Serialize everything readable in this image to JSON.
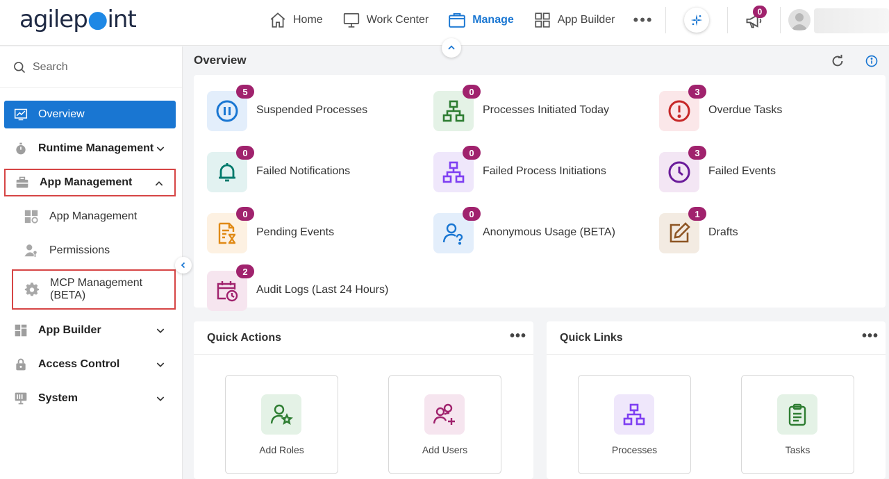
{
  "header": {
    "logo_text": "agilepoint",
    "nav": [
      {
        "label": "Home",
        "icon": "home-icon"
      },
      {
        "label": "Work Center",
        "icon": "monitor-icon"
      },
      {
        "label": "Manage",
        "icon": "briefcase-icon",
        "active": true
      },
      {
        "label": "App Builder",
        "icon": "grid-icon"
      }
    ],
    "more_label": "•••",
    "notification_count": "0",
    "accent_color": "#1976d2",
    "badge_color": "#a0226d"
  },
  "sidebar": {
    "search_placeholder": "Search",
    "items": [
      {
        "label": "Overview",
        "icon": "chart-icon",
        "active": true
      },
      {
        "label": "Runtime Management",
        "icon": "stopwatch-icon"
      },
      {
        "label": "App Management",
        "icon": "toolbox-icon",
        "expanded": true
      },
      {
        "label": "App Builder",
        "icon": "blocks-icon"
      },
      {
        "label": "Access Control",
        "icon": "lock-icon"
      },
      {
        "label": "System",
        "icon": "server-icon"
      }
    ],
    "sub_items": [
      {
        "label": "App Management",
        "icon": "app-settings-icon"
      },
      {
        "label": "Permissions",
        "icon": "user-key-icon"
      },
      {
        "label": "MCP Management (BETA)",
        "icon": "gear-icon"
      }
    ]
  },
  "overview": {
    "title": "Overview",
    "tiles": [
      {
        "label": "Suspended Processes",
        "count": "5",
        "icon": "pause-icon"
      },
      {
        "label": "Processes Initiated Today",
        "count": "0",
        "icon": "hierarchy-icon"
      },
      {
        "label": "Overdue Tasks",
        "count": "3",
        "icon": "alert-icon"
      },
      {
        "label": "Failed Notifications",
        "count": "0",
        "icon": "bell-icon"
      },
      {
        "label": "Failed Process Initiations",
        "count": "0",
        "icon": "hierarchy-icon"
      },
      {
        "label": "Failed Events",
        "count": "3",
        "icon": "clock-icon"
      },
      {
        "label": "Pending Events",
        "count": "0",
        "icon": "document-hourglass-icon"
      },
      {
        "label": "Anonymous Usage (BETA)",
        "count": "0",
        "icon": "user-question-icon"
      },
      {
        "label": "Drafts",
        "count": "1",
        "icon": "edit-icon"
      },
      {
        "label": "Audit Logs (Last 24 Hours)",
        "count": "2",
        "icon": "calendar-clock-icon"
      }
    ]
  },
  "quick_actions": {
    "title": "Quick Actions",
    "more_label": "•••",
    "items": [
      {
        "label": "Add Roles",
        "icon": "user-star-icon"
      },
      {
        "label": "Add Users",
        "icon": "user-plus-icon"
      }
    ]
  },
  "quick_links": {
    "title": "Quick Links",
    "more_label": "•••",
    "items": [
      {
        "label": "Processes",
        "icon": "hierarchy-icon"
      },
      {
        "label": "Tasks",
        "icon": "clipboard-icon"
      }
    ]
  }
}
